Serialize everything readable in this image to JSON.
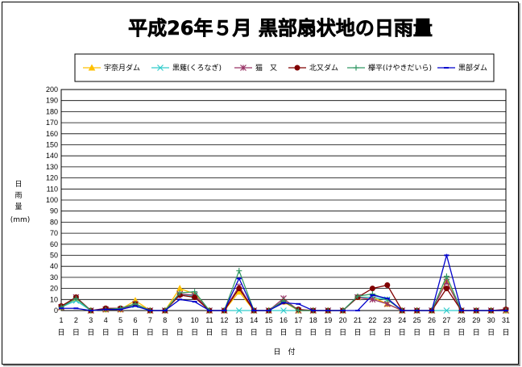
{
  "chart_data": {
    "type": "line",
    "title": "平成26年５月 黒部扇状地の日雨量",
    "ylabel_chars": [
      "日",
      "雨",
      "量"
    ],
    "yunit": "(mm)",
    "xlabel": "日　付",
    "x_suffix": "日",
    "ylim": [
      0,
      200
    ],
    "ytick_step": 10,
    "grid": true,
    "legend_position": "top",
    "x": [
      1,
      2,
      3,
      4,
      5,
      6,
      7,
      8,
      9,
      10,
      11,
      12,
      13,
      14,
      15,
      16,
      17,
      18,
      19,
      20,
      21,
      22,
      23,
      24,
      25,
      26,
      27,
      28,
      29,
      30,
      31
    ],
    "series": [
      {
        "name": "宇奈月ダム",
        "color": "#ffc000",
        "marker": "triangle",
        "values": [
          3,
          11,
          0,
          1,
          1,
          9,
          0,
          0,
          20,
          15,
          0,
          0,
          17,
          0,
          0,
          8,
          0,
          0,
          0,
          0,
          12,
          12,
          6,
          0,
          0,
          0,
          27,
          0,
          0,
          0,
          0
        ]
      },
      {
        "name": "黒薙(くろなぎ)",
        "color": "#33cccc",
        "marker": "x",
        "values": [
          3,
          9,
          0,
          1,
          1,
          5,
          0,
          0,
          15,
          13,
          0,
          0,
          0,
          0,
          0,
          0,
          0,
          0,
          0,
          0,
          12,
          12,
          10,
          0,
          0,
          0,
          0,
          0,
          0,
          0,
          0
        ]
      },
      {
        "name": "猫　又",
        "color": "#993366",
        "marker": "star",
        "values": [
          3,
          12,
          0,
          1,
          1,
          6,
          0,
          0,
          15,
          14,
          0,
          0,
          22,
          0,
          0,
          11,
          0,
          0,
          0,
          0,
          12,
          10,
          6,
          0,
          0,
          0,
          26,
          0,
          0,
          0,
          0
        ]
      },
      {
        "name": "北又ダム",
        "color": "#800000",
        "marker": "circle",
        "values": [
          4,
          12,
          0,
          2,
          2,
          6,
          0,
          0,
          14,
          12,
          0,
          0,
          20,
          0,
          0,
          8,
          1,
          0,
          0,
          0,
          12,
          20,
          23,
          0,
          0,
          0,
          20,
          0,
          0,
          0,
          1
        ]
      },
      {
        "name": "欅平(けやきだいら)",
        "color": "#339966",
        "marker": "plus",
        "values": [
          3,
          11,
          0,
          1,
          2,
          6,
          0,
          0,
          16,
          17,
          0,
          0,
          36,
          0,
          0,
          9,
          0,
          0,
          0,
          0,
          13,
          15,
          10,
          0,
          0,
          0,
          31,
          0,
          0,
          0,
          0
        ]
      },
      {
        "name": "黒部ダム",
        "color": "#0000cc",
        "marker": "dash",
        "values": [
          2,
          2,
          0,
          1,
          1,
          4,
          0,
          0,
          10,
          8,
          0,
          0,
          29,
          0,
          0,
          7,
          6,
          0,
          0,
          0,
          0,
          14,
          11,
          0,
          0,
          0,
          50,
          0,
          0,
          0,
          0
        ]
      }
    ]
  }
}
